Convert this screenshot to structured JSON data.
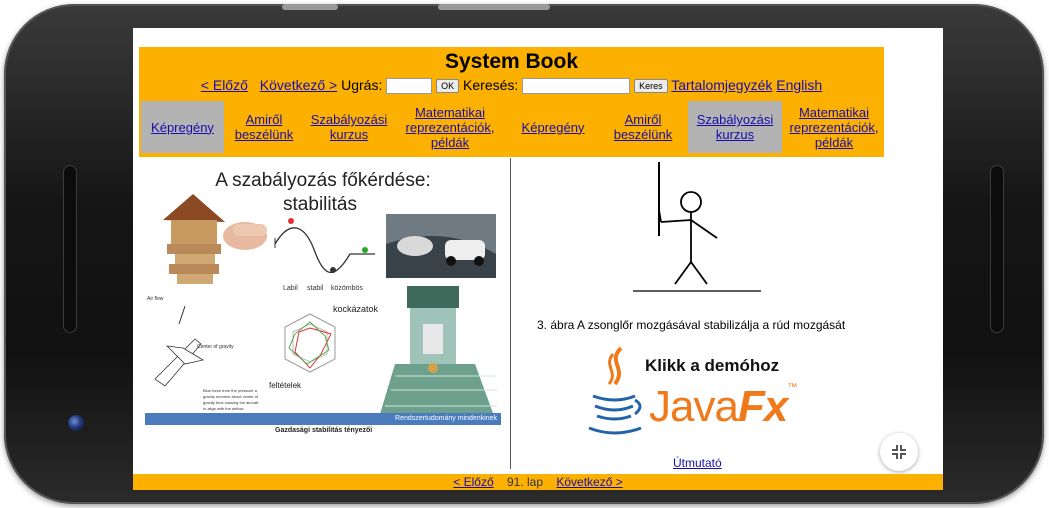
{
  "book": {
    "title": "System Book",
    "prev": "< Előző",
    "next": "Következő >",
    "jump_label": "Ugrás:",
    "ok": "OK",
    "search_label": "Keresés:",
    "search_button": "Keres",
    "toc": "Tartalomjegyzék",
    "english": "English"
  },
  "tabs": [
    {
      "label": "Képregény"
    },
    {
      "label": "Amiről beszélünk"
    },
    {
      "label": "Szabályozási kurzus"
    },
    {
      "label": "Matematikai reprezentációk, példák"
    },
    {
      "label": "Képregény"
    },
    {
      "label": "Amiről beszélünk"
    },
    {
      "label": "Szabályozási kurzus"
    },
    {
      "label": "Matematikai reprezentációk, példák"
    }
  ],
  "slide": {
    "heading_line1": "A szabályozás főkérdése:",
    "heading_line2": "stabilitás",
    "stability_labels": [
      "Labil",
      "stabil",
      "közömbös"
    ],
    "airplane_label": "Air flow",
    "cg_label": "Center of gravity",
    "airplane_desc_1": "Blue force from the pressure a",
    "airplane_desc_2": "gravity moment about center of",
    "airplane_desc_3": "gravity thus causing the aircraft",
    "airplane_desc_4": "to align with the airflow",
    "risk_label": "kockázatok",
    "conditions_label": "feltételek",
    "economic_label": "Gazdasági stabilitás tényezői",
    "banner": "Rendszertudomány mindenkinek"
  },
  "figure": {
    "caption": "3. ábra A zsonglőr mozgásával stabilizálja a rúd mozgását",
    "demo_text": "Klikk a demóhoz",
    "javafx_java": "Java",
    "javafx_fx": "Fx",
    "tm": "™",
    "guide": "Útmutató"
  },
  "footer": {
    "prev": "< Előző",
    "page": "91. lap",
    "next": "Következő >"
  },
  "colors": {
    "header_bg": "#fcb000",
    "link": "#1a0dab",
    "tab_highlight": "#b3b3b3",
    "javafx_orange": "#f07a1b",
    "java_blue": "#2364a8"
  }
}
